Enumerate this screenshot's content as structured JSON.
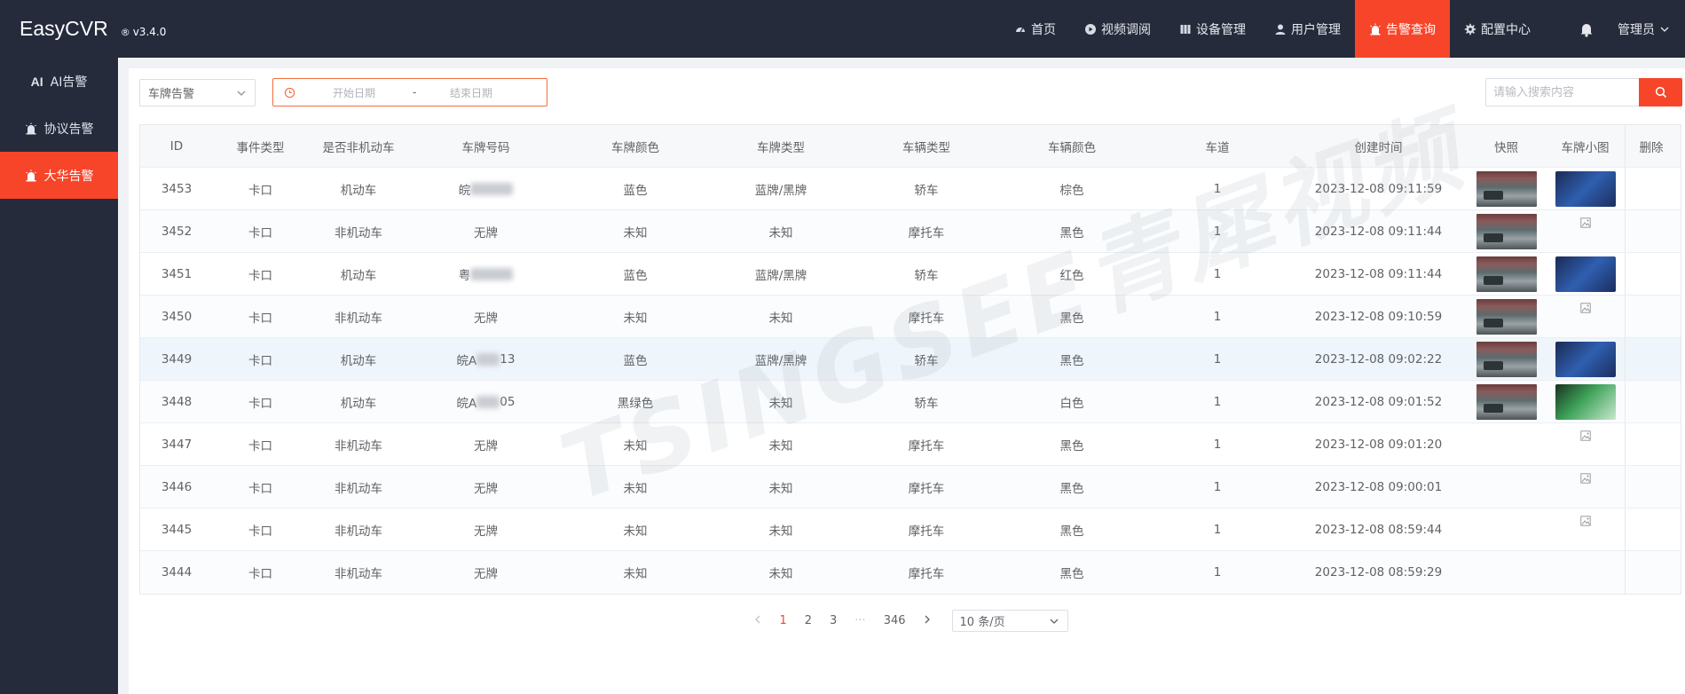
{
  "app": {
    "name": "EasyCVR",
    "reg": "®",
    "version": "v3.4.0"
  },
  "nav": [
    {
      "label": "首页",
      "icon": "dashboard-icon",
      "active": false
    },
    {
      "label": "视频调阅",
      "icon": "play-circle-icon",
      "active": false
    },
    {
      "label": "设备管理",
      "icon": "device-icon",
      "active": false
    },
    {
      "label": "用户管理",
      "icon": "user-icon",
      "active": false
    },
    {
      "label": "告警查询",
      "icon": "alarm-icon",
      "active": true
    },
    {
      "label": "配置中心",
      "icon": "gear-icon",
      "active": false
    }
  ],
  "user": {
    "label": "管理员"
  },
  "sidebar": [
    {
      "label": "AI告警",
      "prefix": "AI",
      "active": false
    },
    {
      "label": "协议告警",
      "active": false
    },
    {
      "label": "大华告警",
      "active": true
    }
  ],
  "filters": {
    "type_value": "车牌告警",
    "start_placeholder": "开始日期",
    "separator": "-",
    "end_placeholder": "结束日期",
    "search_placeholder": "请输入搜索内容"
  },
  "table": {
    "headers": [
      "ID",
      "事件类型",
      "是否非机动车",
      "车牌号码",
      "车牌颜色",
      "车牌类型",
      "车辆类型",
      "车辆颜色",
      "车道",
      "创建时间",
      "快照",
      "车牌小图",
      "删除"
    ],
    "rows": [
      {
        "id": "3453",
        "event": "卡口",
        "motor": "机动车",
        "plate_prefix": "皖",
        "plate_suffix": "",
        "plate_color": "蓝色",
        "plate_type": "蓝牌/黑牌",
        "vehicle_type": "轿车",
        "vehicle_color": "棕色",
        "lane": "1",
        "time": "2023-12-08 09:11:59",
        "snapshot": true,
        "plate_img": "blue"
      },
      {
        "id": "3452",
        "event": "卡口",
        "motor": "非机动车",
        "plate_prefix": "无牌",
        "plate_suffix": "",
        "plate_color": "未知",
        "plate_type": "未知",
        "vehicle_type": "摩托车",
        "vehicle_color": "黑色",
        "lane": "1",
        "time": "2023-12-08 09:11:44",
        "snapshot": true,
        "plate_img": "icon"
      },
      {
        "id": "3451",
        "event": "卡口",
        "motor": "机动车",
        "plate_prefix": "粤",
        "plate_suffix": "",
        "plate_color": "蓝色",
        "plate_type": "蓝牌/黑牌",
        "vehicle_type": "轿车",
        "vehicle_color": "红色",
        "lane": "1",
        "time": "2023-12-08 09:11:44",
        "snapshot": true,
        "plate_img": "blue"
      },
      {
        "id": "3450",
        "event": "卡口",
        "motor": "非机动车",
        "plate_prefix": "无牌",
        "plate_suffix": "",
        "plate_color": "未知",
        "plate_type": "未知",
        "vehicle_type": "摩托车",
        "vehicle_color": "黑色",
        "lane": "1",
        "time": "2023-12-08 09:10:59",
        "snapshot": true,
        "plate_img": "icon"
      },
      {
        "id": "3449",
        "event": "卡口",
        "motor": "机动车",
        "plate_prefix": "皖A",
        "plate_suffix": "13",
        "plate_color": "蓝色",
        "plate_type": "蓝牌/黑牌",
        "vehicle_type": "轿车",
        "vehicle_color": "黑色",
        "lane": "1",
        "time": "2023-12-08 09:02:22",
        "snapshot": true,
        "plate_img": "blue",
        "highlight": true
      },
      {
        "id": "3448",
        "event": "卡口",
        "motor": "机动车",
        "plate_prefix": "皖A",
        "plate_suffix": "05",
        "plate_color": "黑绿色",
        "plate_type": "未知",
        "vehicle_type": "轿车",
        "vehicle_color": "白色",
        "lane": "1",
        "time": "2023-12-08 09:01:52",
        "snapshot": true,
        "plate_img": "green"
      },
      {
        "id": "3447",
        "event": "卡口",
        "motor": "非机动车",
        "plate_prefix": "无牌",
        "plate_suffix": "",
        "plate_color": "未知",
        "plate_type": "未知",
        "vehicle_type": "摩托车",
        "vehicle_color": "黑色",
        "lane": "1",
        "time": "2023-12-08 09:01:20",
        "snapshot": false,
        "plate_img": "icon"
      },
      {
        "id": "3446",
        "event": "卡口",
        "motor": "非机动车",
        "plate_prefix": "无牌",
        "plate_suffix": "",
        "plate_color": "未知",
        "plate_type": "未知",
        "vehicle_type": "摩托车",
        "vehicle_color": "黑色",
        "lane": "1",
        "time": "2023-12-08 09:00:01",
        "snapshot": false,
        "plate_img": "icon"
      },
      {
        "id": "3445",
        "event": "卡口",
        "motor": "非机动车",
        "plate_prefix": "无牌",
        "plate_suffix": "",
        "plate_color": "未知",
        "plate_type": "未知",
        "vehicle_type": "摩托车",
        "vehicle_color": "黑色",
        "lane": "1",
        "time": "2023-12-08 08:59:44",
        "snapshot": false,
        "plate_img": "icon"
      },
      {
        "id": "3444",
        "event": "卡口",
        "motor": "非机动车",
        "plate_prefix": "无牌",
        "plate_suffix": "",
        "plate_color": "未知",
        "plate_type": "未知",
        "vehicle_type": "摩托车",
        "vehicle_color": "黑色",
        "lane": "1",
        "time": "2023-12-08 08:59:29",
        "snapshot": false,
        "plate_img": "none"
      }
    ]
  },
  "pagination": {
    "pages": [
      "1",
      "2",
      "3",
      "···",
      "346"
    ],
    "current": "1",
    "page_size": "10 条/页"
  },
  "watermark": "TSINGSEE青犀视频",
  "colors": {
    "accent": "#f7452a",
    "header_bg": "#252b3b"
  }
}
